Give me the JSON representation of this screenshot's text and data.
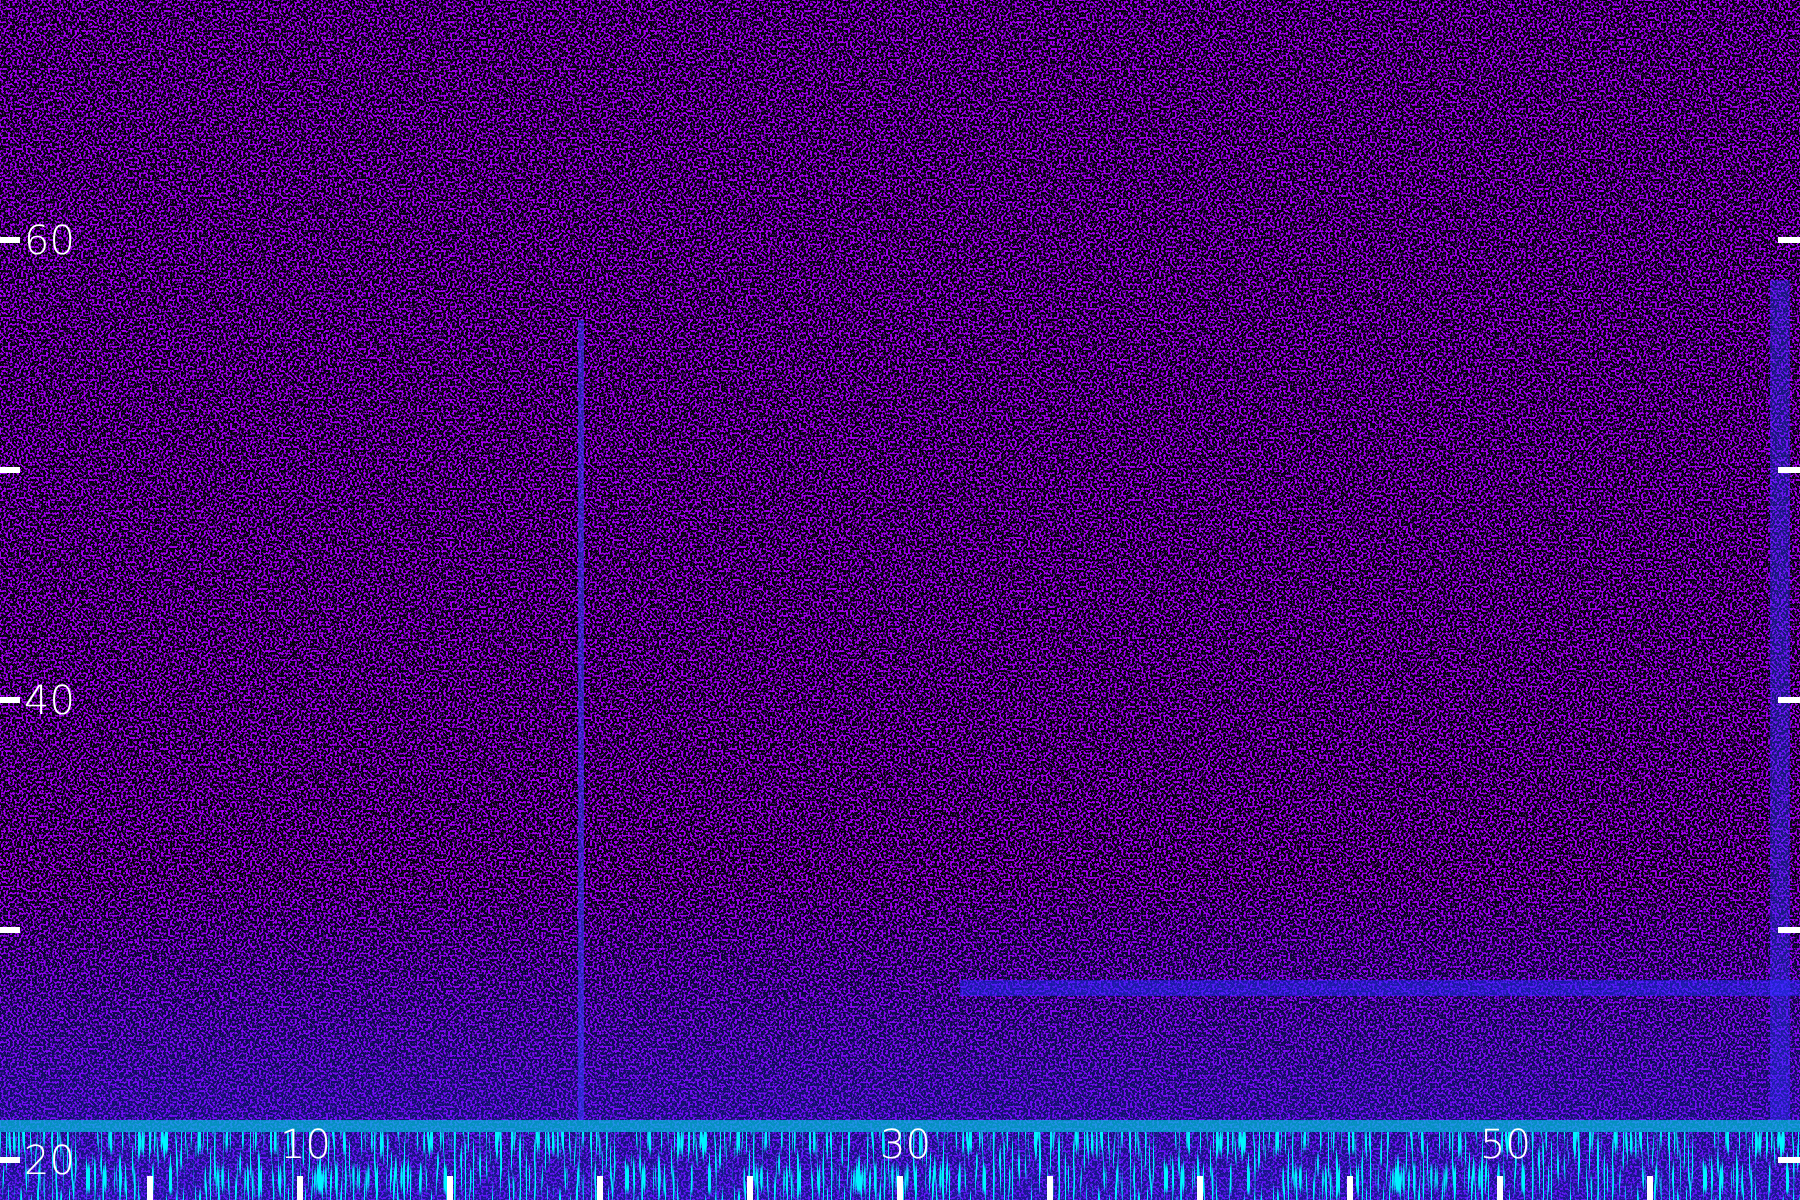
{
  "spectrogram": {
    "y_axis_labels": [
      "60",
      "40",
      "20"
    ],
    "x_axis_labels": [
      "10",
      "30",
      "50"
    ]
  }
}
